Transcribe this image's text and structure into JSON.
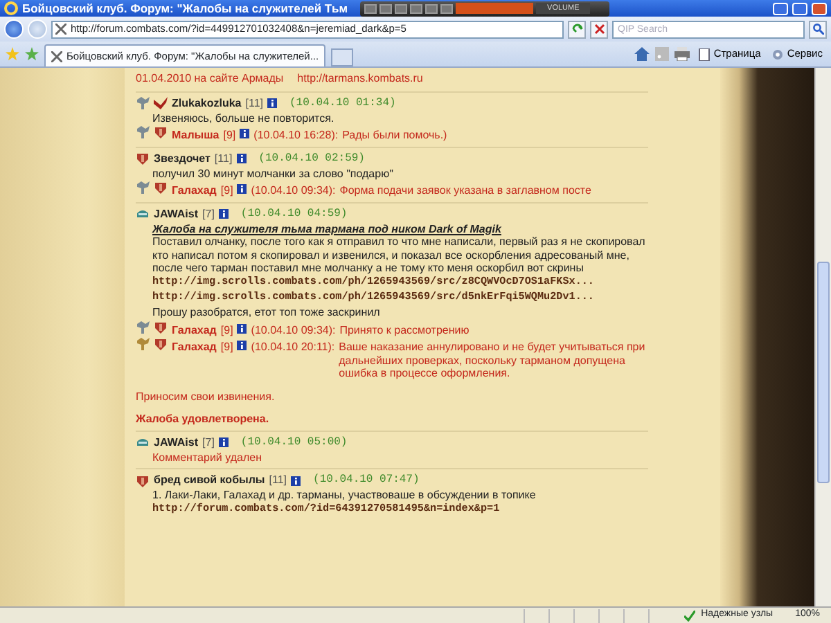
{
  "window": {
    "title": "Бойцовский клуб. Форум: \"Жалобы на служителей Тьм",
    "player_label": "VOLUME"
  },
  "toolbar": {
    "address": "http://forum.combats.com/?id=449912701032408&n=jeremiad_dark&p=5",
    "search": {
      "placeholder": "QIP Search"
    }
  },
  "tabs": [
    {
      "label": "Бойцовский клуб. Форум: \"Жалобы на служителей...",
      "selected": true
    }
  ],
  "commands": [
    "Страница",
    "Сервис"
  ],
  "top_continuation": [
    {
      "kind": "text",
      "text": "01.04.2010 на сайте Армады"
    },
    {
      "kind": "link",
      "text": "http://tarmans.kombats.ru"
    }
  ],
  "posts": [
    {
      "icons": [
        {
          "kind": "crest"
        },
        {
          "kind": "wings"
        }
      ],
      "author": "Zlukakozluka",
      "level": "[11]",
      "time": "(10.04.10 01:34)",
      "body": [
        {
          "kind": "text",
          "text": "Извеняюсь, больше не повторится."
        }
      ],
      "replies": [
        {
          "icons": [
            {
              "kind": "crest"
            },
            {
              "kind": "shield"
            }
          ],
          "author": "Малыша",
          "level": "[9]",
          "time": "(10.04.10 16:28):",
          "paragraphs": [
            {
              "kind": "text",
              "text": "Рады были помочь.)"
            }
          ]
        }
      ]
    },
    {
      "icons": [
        {
          "kind": "shield"
        }
      ],
      "author": "Звездочет",
      "level": "[11]",
      "time": "(10.04.10 02:59)",
      "body": [
        {
          "kind": "text",
          "text": "получил 30 минут молчанки за слово \"подарю\""
        }
      ],
      "replies": [
        {
          "icons": [
            {
              "kind": "crest"
            },
            {
              "kind": "shield"
            }
          ],
          "author": "Галахад",
          "level": "[9]",
          "time": "(10.04.10 09:34):",
          "paragraphs": [
            {
              "kind": "text",
              "text": "Форма подачи заявок указана в заглавном посте"
            }
          ]
        }
      ]
    },
    {
      "icons": [
        {
          "kind": "helmet"
        }
      ],
      "author": "JAWAist",
      "level": "[7]",
      "time": "(10.04.10 04:59)",
      "body": [
        {
          "kind": "title",
          "text": "Жалоба на служителя тьма тармана под ником Dark of Magik"
        },
        {
          "kind": "text",
          "text": "Поставил олчанку, после того как я отправил то что мне написали, первый раз я не скопировал кто написал потом я скопировал и извенился, и показал все оскорбления адресованый мне, после чего тарман поставил мне молчанку а не тому кто меня оскорбил вот скрины"
        },
        {
          "kind": "link",
          "text": "http://img.scrolls.combats.com/ph/1265943569/src/z8CQWVOcD7OS1aFKSx..."
        },
        {
          "kind": "link",
          "text": "http://img.scrolls.combats.com/ph/1265943569/src/d5nkErFqi5WQMu2Dv1..."
        },
        {
          "kind": "text",
          "text": "Прошу разобратся, етот топ тоже заскринил"
        }
      ],
      "replies": [
        {
          "icons": [
            {
              "kind": "crest"
            },
            {
              "kind": "shield"
            }
          ],
          "author": "Галахад",
          "level": "[9]",
          "time": "(10.04.10 09:34):",
          "paragraphs": [
            {
              "kind": "text",
              "text": "Принято к рассмотрению"
            }
          ]
        },
        {
          "icons": [
            {
              "kind": "gold-crest"
            },
            {
              "kind": "shield"
            }
          ],
          "author": "Галахад",
          "level": "[9]",
          "time": "(10.04.10 20:11):",
          "paragraphs": [
            {
              "kind": "text",
              "text": "Ваше наказание аннулировано и не будет учитываться при дальнейших проверках, поскольку тарманом допущена ошибка в процессе оформления."
            },
            {
              "kind": "text",
              "text": "Приносим свои извинения."
            },
            {
              "kind": "bold",
              "text": "Жалоба удовлетворена."
            }
          ]
        }
      ]
    },
    {
      "icons": [
        {
          "kind": "helmet"
        }
      ],
      "author": "JAWAist",
      "level": "[7]",
      "time": "(10.04.10 05:00)",
      "body": [
        {
          "kind": "deleted",
          "text": "Комментарий удален"
        }
      ]
    },
    {
      "icons": [
        {
          "kind": "shield"
        }
      ],
      "author": "бред сивой кобылы",
      "level": "[11]",
      "time": "(10.04.10 07:47)",
      "body": [
        {
          "kind": "text",
          "text": "1. Лаки-Лаки, Галахад и др. тарманы, участвоваше в обсуждении в топике"
        },
        {
          "kind": "link",
          "text": "http://forum.combats.com/?id=64391270581495&n=index&p=1"
        }
      ]
    }
  ],
  "status_bar": {
    "zone": "Надежные узлы",
    "zoom": "100%"
  }
}
